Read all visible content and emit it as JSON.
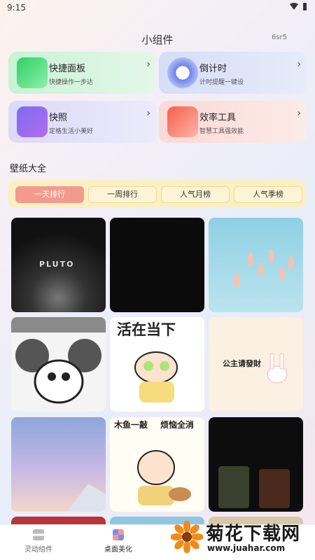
{
  "status": {
    "time": "9:15"
  },
  "header": {
    "title": "小组件",
    "corner_text": "6sr5"
  },
  "widgets": [
    {
      "name": "快捷面板",
      "desc": "快捷操作一步达"
    },
    {
      "name": "倒计时",
      "desc": "计时提醒一键设"
    },
    {
      "name": "快照",
      "desc": "定格生活小美好"
    },
    {
      "name": "效率工具",
      "desc": "智慧工具强效能"
    }
  ],
  "wallpaper": {
    "title": "壁纸大全",
    "tabs": [
      "一天排行",
      "一周排行",
      "人气月榜",
      "人气季榜"
    ],
    "active_tab": "一天排行",
    "tile_captions": [
      "PLUTO",
      "活在当下",
      "公主请發財",
      "木鱼一敲",
      "烦恼全消"
    ]
  },
  "bottom_nav": [
    {
      "label": "灵动组件"
    },
    {
      "label": "桌面美化"
    }
  ],
  "watermark": {
    "name": "菊花下载网",
    "url": "www.juahar.com"
  },
  "colors": {
    "active_tab": "#f39a8e",
    "tabbar_bg": "#fbefc4"
  },
  "icons": [
    "wifi-icon",
    "battery-icon",
    "chevron-right-icon",
    "flower-logo-icon"
  ]
}
